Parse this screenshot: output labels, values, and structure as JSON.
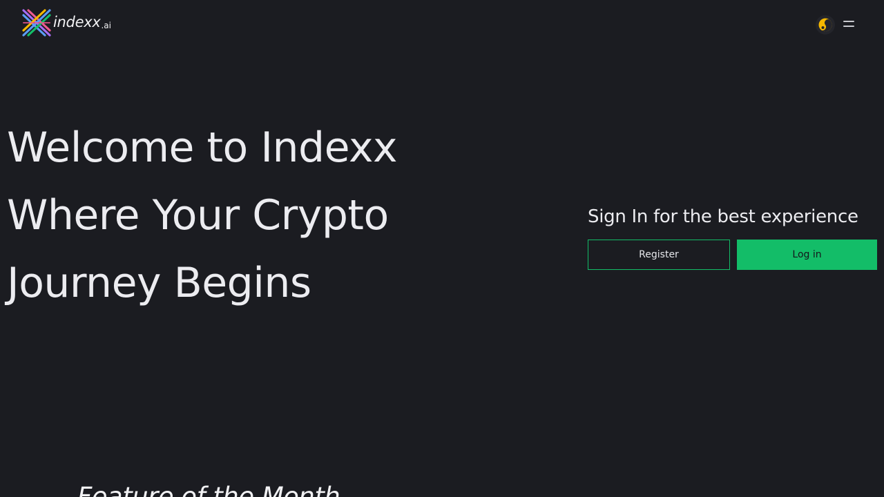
{
  "header": {
    "logo_text": "indexx",
    "logo_tld": ".ai",
    "theme_toggle_icon": "theme-toggle-icon",
    "menu_icon": "hamburger-menu-icon"
  },
  "hero": {
    "line1": "Welcome to Indexx",
    "line2": "Where Your Crypto",
    "line3": "Journey Begins"
  },
  "signin": {
    "title": "Sign In for the best experience",
    "register_label": "Register",
    "login_label": "Log in"
  },
  "feature": {
    "title": "Feature of the Month"
  },
  "colors": {
    "background": "#1b1c21",
    "accent_green": "#13bd68",
    "text_primary": "#ececf0",
    "toggle_accent": "#f5b800"
  }
}
